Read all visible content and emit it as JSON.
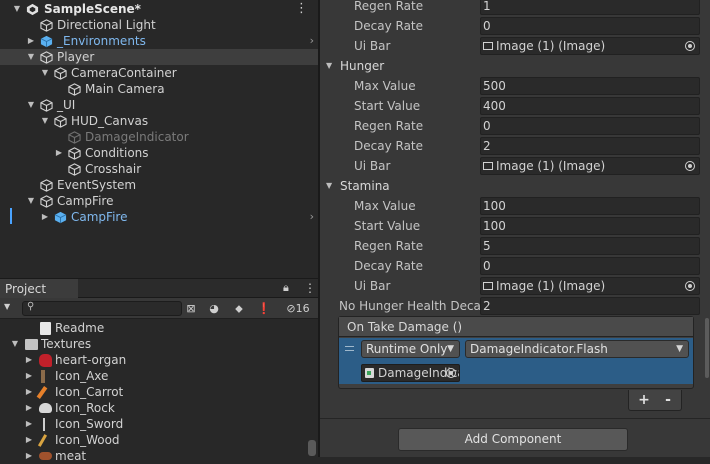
{
  "hierarchy": {
    "scene": "SampleScene*",
    "items": [
      {
        "label": "Directional Light"
      },
      {
        "label": "_Environments"
      },
      {
        "label": "Player"
      },
      {
        "label": "CameraContainer"
      },
      {
        "label": "Main Camera"
      },
      {
        "label": "_UI"
      },
      {
        "label": "HUD_Canvas"
      },
      {
        "label": "DamageIndicator"
      },
      {
        "label": "Conditions"
      },
      {
        "label": "Crosshair"
      },
      {
        "label": "EventSystem"
      },
      {
        "label": "CampFire"
      },
      {
        "label": "CampFire"
      }
    ]
  },
  "project": {
    "tab": "Project",
    "hidden_count": "16",
    "items": [
      {
        "label": "Readme"
      },
      {
        "label": "Textures"
      },
      {
        "label": "heart-organ"
      },
      {
        "label": "Icon_Axe"
      },
      {
        "label": "Icon_Carrot"
      },
      {
        "label": "Icon_Rock"
      },
      {
        "label": "Icon_Sword"
      },
      {
        "label": "Icon_Wood"
      },
      {
        "label": "meat"
      }
    ]
  },
  "inspector": {
    "top": {
      "regen_label": "Regen Rate",
      "regen_value": "1",
      "decay_label": "Decay Rate",
      "decay_value": "0",
      "uibar_label": "Ui Bar",
      "uibar_value": "Image (1) (Image)"
    },
    "hunger": {
      "title": "Hunger",
      "max_label": "Max Value",
      "max_value": "500",
      "start_label": "Start Value",
      "start_value": "400",
      "regen_label": "Regen Rate",
      "regen_value": "0",
      "decay_label": "Decay Rate",
      "decay_value": "2",
      "uibar_label": "Ui Bar",
      "uibar_value": "Image (1) (Image)"
    },
    "stamina": {
      "title": "Stamina",
      "max_label": "Max Value",
      "max_value": "100",
      "start_label": "Start Value",
      "start_value": "100",
      "regen_label": "Regen Rate",
      "regen_value": "5",
      "decay_label": "Decay Rate",
      "decay_value": "0",
      "uibar_label": "Ui Bar",
      "uibar_value": "Image (1) (Image)"
    },
    "no_hunger_label": "No Hunger Health Decay",
    "no_hunger_value": "2",
    "event": {
      "title": "On Take Damage ()",
      "runtime": "Runtime Only",
      "function": "DamageIndicator.Flash",
      "object": "DamageIndicator"
    },
    "plus": "+",
    "minus": "-",
    "add_component": "Add Component"
  }
}
